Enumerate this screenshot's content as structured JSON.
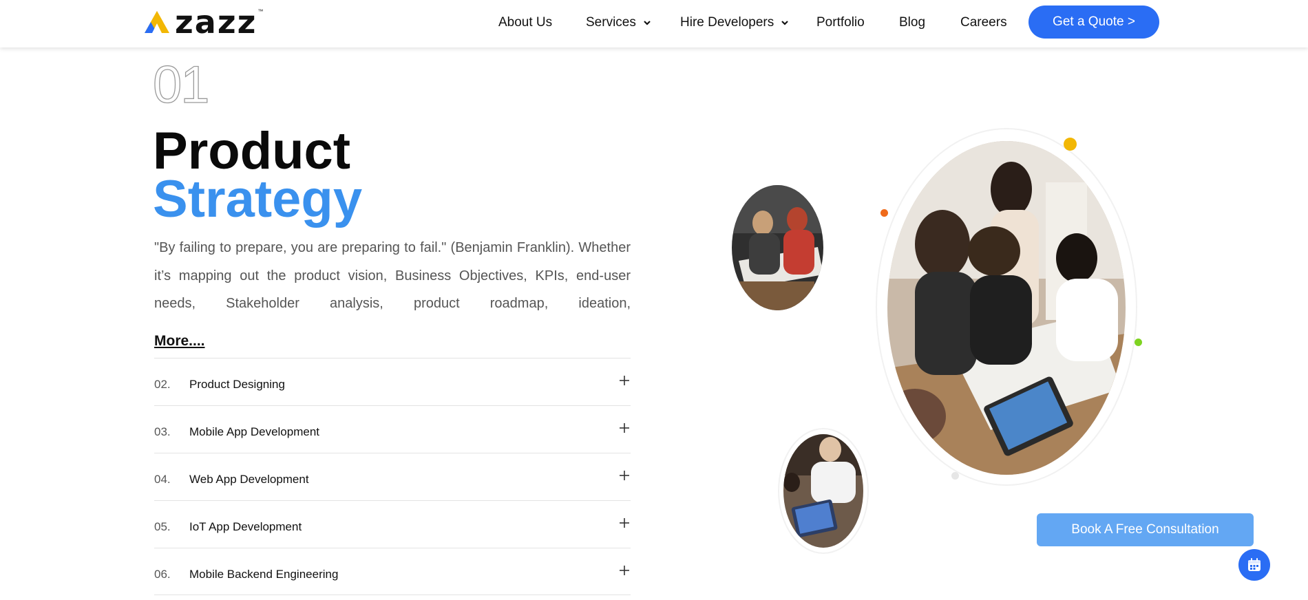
{
  "header": {
    "logo_text": "zazz",
    "logo_tm": "™",
    "nav": [
      {
        "label": "About Us",
        "dropdown": false
      },
      {
        "label": "Services",
        "dropdown": true
      },
      {
        "label": "Hire Developers",
        "dropdown": true
      },
      {
        "label": "Portfolio",
        "dropdown": false
      },
      {
        "label": "Blog",
        "dropdown": false
      },
      {
        "label": "Careers",
        "dropdown": false
      }
    ],
    "cta_label": "Get a Quote >"
  },
  "section": {
    "number": "01",
    "title_line1": "Product",
    "title_line2": "Strategy",
    "quote": "\"By failing to prepare, you are preparing to fail.\" (Benjamin Franklin). Whether it’s mapping out the product vision, Business Objectives, KPIs, end-user needs, Stakeholder analysis, product roadmap, ideation,",
    "more_label": "More....",
    "items": [
      {
        "num": "02.",
        "label": "Product Designing"
      },
      {
        "num": "03.",
        "label": "Mobile App Development"
      },
      {
        "num": "04.",
        "label": "Web App Development"
      },
      {
        "num": "05.",
        "label": "IoT App Development"
      },
      {
        "num": "06.",
        "label": "Mobile Backend Engineering"
      }
    ]
  },
  "consult_label": "Book A Free Consultation",
  "colors": {
    "brand_blue": "#2a6df4",
    "title_blue": "#3a91ee",
    "consult_blue": "#63a7f3",
    "dot_yellow": "#f2b705",
    "dot_orange": "#ef6a1a",
    "dot_green": "#7ed321"
  },
  "icons": [
    "logo-triangle-icon",
    "chevron-down-icon",
    "plus-icon",
    "calendar-icon"
  ]
}
